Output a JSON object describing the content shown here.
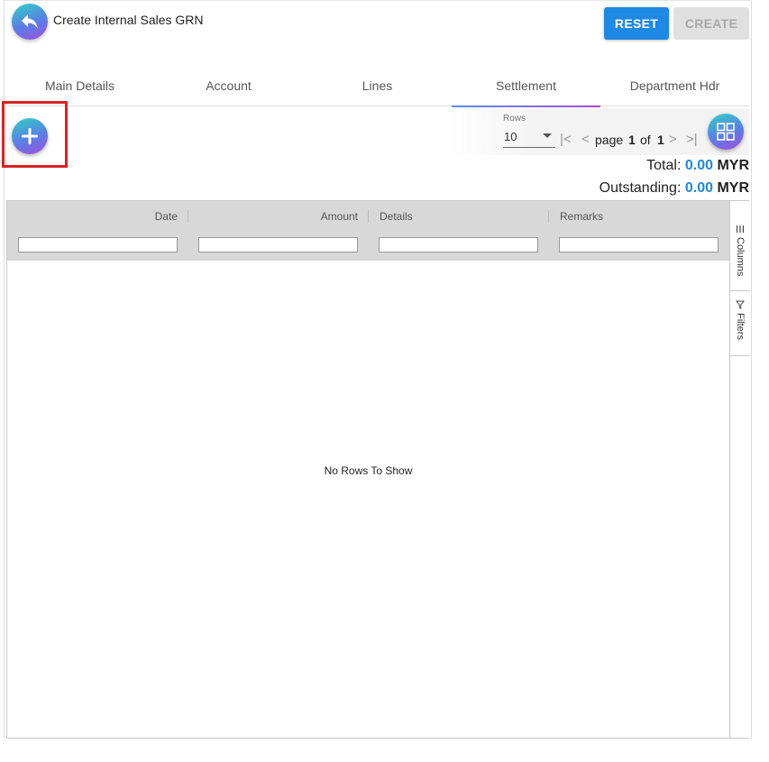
{
  "header": {
    "title": "Create Internal Sales GRN",
    "reset_label": "RESET",
    "create_label": "CREATE"
  },
  "tabs": [
    {
      "label": "Main Details"
    },
    {
      "label": "Account"
    },
    {
      "label": "Lines"
    },
    {
      "label": "Settlement",
      "active": true
    },
    {
      "label": "Department Hdr"
    }
  ],
  "pagination": {
    "rows_label": "Rows",
    "rows_value": "10",
    "page_word": "page",
    "current_page": "1",
    "of_word": "of",
    "total_pages": "1"
  },
  "summary": {
    "total_label": "Total:",
    "total_amount": "0.00",
    "outstanding_label": "Outstanding:",
    "outstanding_amount": "0.00",
    "currency": "MYR"
  },
  "grid": {
    "columns": [
      "Date",
      "Amount",
      "Details",
      "Remarks"
    ],
    "empty_message": "No Rows To Show",
    "side_tabs": [
      "Columns",
      "Filters"
    ]
  },
  "colors": {
    "primary": "#1e88e5",
    "highlight": "#e02020",
    "gradient_start": "#2fd3c6",
    "gradient_end": "#a04fe0"
  }
}
